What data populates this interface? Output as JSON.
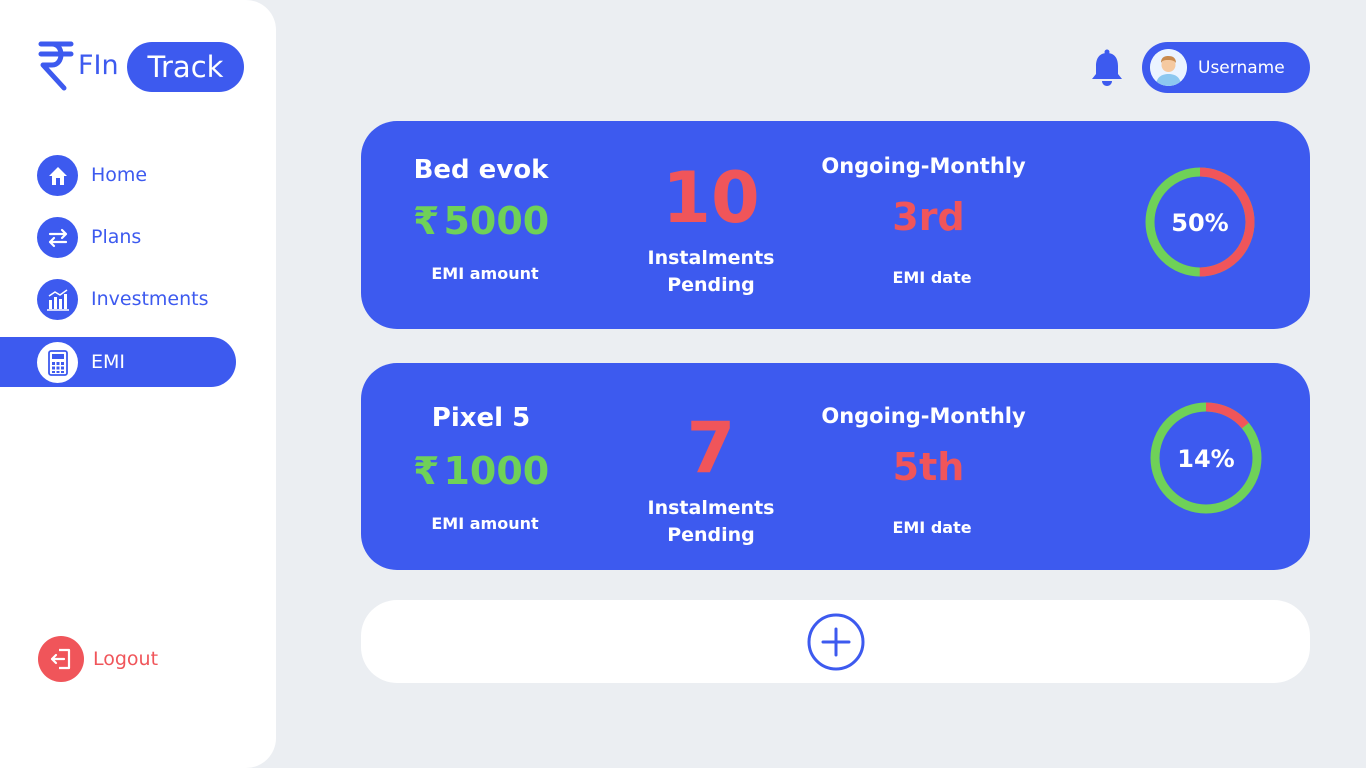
{
  "brand": {
    "logo_part1": "FIn",
    "logo_part2": "Track"
  },
  "sidebar": {
    "items": [
      {
        "label": "Home",
        "icon": "home-icon"
      },
      {
        "label": "Plans",
        "icon": "transfer-arrows-icon"
      },
      {
        "label": "Investments",
        "icon": "bar-chart-icon"
      },
      {
        "label": "EMI",
        "icon": "calculator-icon",
        "active": true
      }
    ],
    "logout_label": "Logout"
  },
  "header": {
    "username": "Username"
  },
  "cards": [
    {
      "title": "Bed evok",
      "currency": "₹",
      "amount": "5000",
      "amount_label": "EMI amount",
      "instalments": "10",
      "instalments_label_1": "Instalments",
      "instalments_label_2": "Pending",
      "status": "Ongoing-Monthly",
      "emi_date": "3rd",
      "emi_date_label": "EMI date",
      "progress_label": "50%",
      "progress": 0.5
    },
    {
      "title": "Pixel 5",
      "currency": "₹",
      "amount": "1000",
      "amount_label": "EMI amount",
      "instalments": "7",
      "instalments_label_1": "Instalments",
      "instalments_label_2": "Pending",
      "status": "Ongoing-Monthly",
      "emi_date": "5th",
      "emi_date_label": "EMI date",
      "progress_label": "14%",
      "progress": 0.14
    }
  ],
  "colors": {
    "primary": "#3D5AEF",
    "green": "#6FD158",
    "red": "#F0555A",
    "background": "#EBEEF2"
  }
}
